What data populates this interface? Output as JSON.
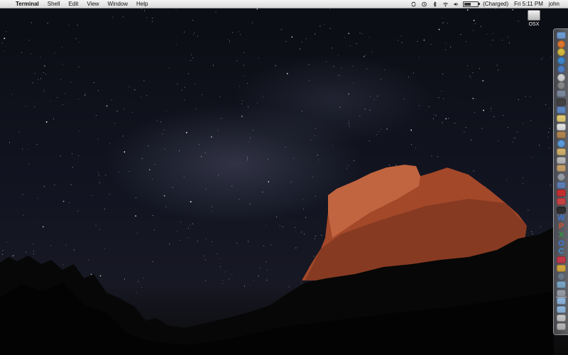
{
  "menubar": {
    "apple_glyph": "",
    "app_name": "Terminal",
    "menus": [
      "Shell",
      "Edit",
      "View",
      "Window",
      "Help"
    ],
    "status": {
      "battery_text": "(Charged)",
      "clock": "Fri 5:11 PM",
      "user": "john"
    },
    "status_icons": [
      "sync-icon",
      "time-machine-icon",
      "bluetooth-icon",
      "wifi-icon",
      "volume-icon",
      "battery-icon"
    ]
  },
  "desktop": {
    "disk_label": "OSX",
    "wallpaper": "night-sky-mesa"
  },
  "dock": {
    "orientation": "vertical-right",
    "items": [
      {
        "name": "finder-icon",
        "color": "#6fa0d8",
        "shape": "square"
      },
      {
        "name": "firefox-icon",
        "color": "#e8782a",
        "shape": "round"
      },
      {
        "name": "chrome-icon",
        "color": "#e0c23a",
        "shape": "round"
      },
      {
        "name": "safari-icon",
        "color": "#3a8ad6",
        "shape": "round"
      },
      {
        "name": "globe-icon",
        "color": "#4a7fc6",
        "shape": "round"
      },
      {
        "name": "compass-icon",
        "color": "#d8d8d8",
        "shape": "round"
      },
      {
        "name": "system-preferences-icon",
        "color": "#8a8a8a",
        "shape": "round"
      },
      {
        "name": "photo-icon",
        "color": "#7d8aa0",
        "shape": "square"
      },
      {
        "name": "facetime-icon",
        "color": "#3f3f3f",
        "shape": "square"
      },
      {
        "name": "mail-icon",
        "color": "#5c89c8",
        "shape": "square"
      },
      {
        "name": "notes-icon",
        "color": "#e8cf72",
        "shape": "square"
      },
      {
        "name": "calendar-icon",
        "color": "#e8e8e8",
        "shape": "square"
      },
      {
        "name": "address-book-icon",
        "color": "#b5864d",
        "shape": "square"
      },
      {
        "name": "itunes-icon",
        "color": "#5aa0e6",
        "shape": "round"
      },
      {
        "name": "preview-icon",
        "color": "#d8b46a",
        "shape": "square"
      },
      {
        "name": "star-app-icon",
        "color": "#bcbcbc",
        "shape": "square"
      },
      {
        "name": "brush-icon",
        "color": "#c9a26a",
        "shape": "square"
      },
      {
        "name": "disk-utility-icon",
        "color": "#9aa0a8",
        "shape": "round"
      },
      {
        "name": "network-icon",
        "color": "#5c7fb8",
        "shape": "square"
      },
      {
        "name": "filezilla-icon",
        "color": "#cf2a2a",
        "shape": "square"
      },
      {
        "name": "parallels-icon",
        "color": "#d04040",
        "shape": "square"
      },
      {
        "name": "terminal-icon",
        "color": "#2a2a2a",
        "shape": "square"
      },
      {
        "name": "word-icon",
        "letter": "W",
        "color": "#3c78d8",
        "shape": "letter"
      },
      {
        "name": "powerpoint-icon",
        "letter": "P",
        "color": "#d8552a",
        "shape": "letter"
      },
      {
        "name": "excel-icon",
        "letter": "X",
        "color": "#2f9a3c",
        "shape": "letter"
      },
      {
        "name": "outlook-icon",
        "letter": "O",
        "color": "#3c78d8",
        "shape": "letter"
      },
      {
        "name": "communicator-icon",
        "letter": "C",
        "color": "#3c90d8",
        "shape": "letter"
      },
      {
        "name": "onenote-icon",
        "color": "#cc3344",
        "shape": "square"
      },
      {
        "name": "people-icon",
        "color": "#d8a83a",
        "shape": "square"
      },
      {
        "name": "vm-icon",
        "color": "#6a7a8a",
        "shape": "round"
      },
      {
        "name": "remote-desktop-icon",
        "color": "#7aa8c8",
        "shape": "square"
      },
      {
        "name": "airport-icon",
        "color": "#9aa0a8",
        "shape": "square"
      },
      {
        "name": "applications-folder-icon",
        "color": "#8fb8e0",
        "shape": "square"
      },
      {
        "name": "documents-folder-icon",
        "color": "#8fb8e0",
        "shape": "square"
      },
      {
        "name": "downloads-stack-icon",
        "color": "#c8c8c8",
        "shape": "square"
      },
      {
        "name": "trash-icon",
        "color": "#b8b8b8",
        "shape": "square"
      }
    ]
  }
}
